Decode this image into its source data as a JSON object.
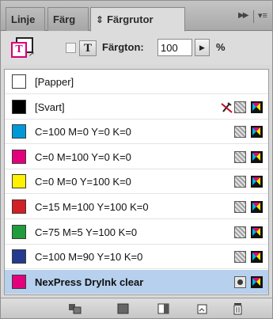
{
  "tabs": [
    {
      "label": "Linje"
    },
    {
      "label": "Färg"
    },
    {
      "label": "Färgrutor",
      "icon": "diamond-arrows-icon",
      "active": true
    }
  ],
  "tab_menu": {
    "forward_icon": "double-chevron-right-icon",
    "options_icon": "panel-menu-icon"
  },
  "tools": {
    "tint_label": "Färgton:",
    "tint_value": "100",
    "tint_unit": "%",
    "text_button": "T",
    "fill_stroke_letter": "T"
  },
  "swatches": [
    {
      "name": "[Papper]",
      "color": "#ffffff",
      "icons": []
    },
    {
      "name": "[Svart]",
      "color": "#000000",
      "icons": [
        "no-edit-icon",
        "process-icon",
        "cmyk-icon"
      ]
    },
    {
      "name": "C=100 M=0 Y=0 K=0",
      "color": "#0099d8",
      "icons": [
        "process-icon",
        "cmyk-icon"
      ]
    },
    {
      "name": "C=0 M=100 Y=0 K=0",
      "color": "#e4007d",
      "icons": [
        "process-icon",
        "cmyk-icon"
      ]
    },
    {
      "name": "C=0 M=0 Y=100 K=0",
      "color": "#fff100",
      "icons": [
        "process-icon",
        "cmyk-icon"
      ]
    },
    {
      "name": "C=15 M=100 Y=100 K=0",
      "color": "#d31f26",
      "icons": [
        "process-icon",
        "cmyk-icon"
      ]
    },
    {
      "name": "C=75 M=5 Y=100 K=0",
      "color": "#1f9c3c",
      "icons": [
        "process-icon",
        "cmyk-icon"
      ]
    },
    {
      "name": "C=100 M=90 Y=10 K=0",
      "color": "#233a8f",
      "icons": [
        "process-icon",
        "cmyk-icon"
      ]
    },
    {
      "name": "NexPress DryInk clear",
      "color": "#e4007d",
      "selected": true,
      "icons": [
        "spot-icon",
        "cmyk-icon"
      ]
    }
  ],
  "bottom_bar": {
    "icons": [
      "swatch-group-icon",
      "new-color-group-icon",
      "tint-swatch-icon",
      "new-swatch-icon",
      "trash-icon"
    ]
  }
}
